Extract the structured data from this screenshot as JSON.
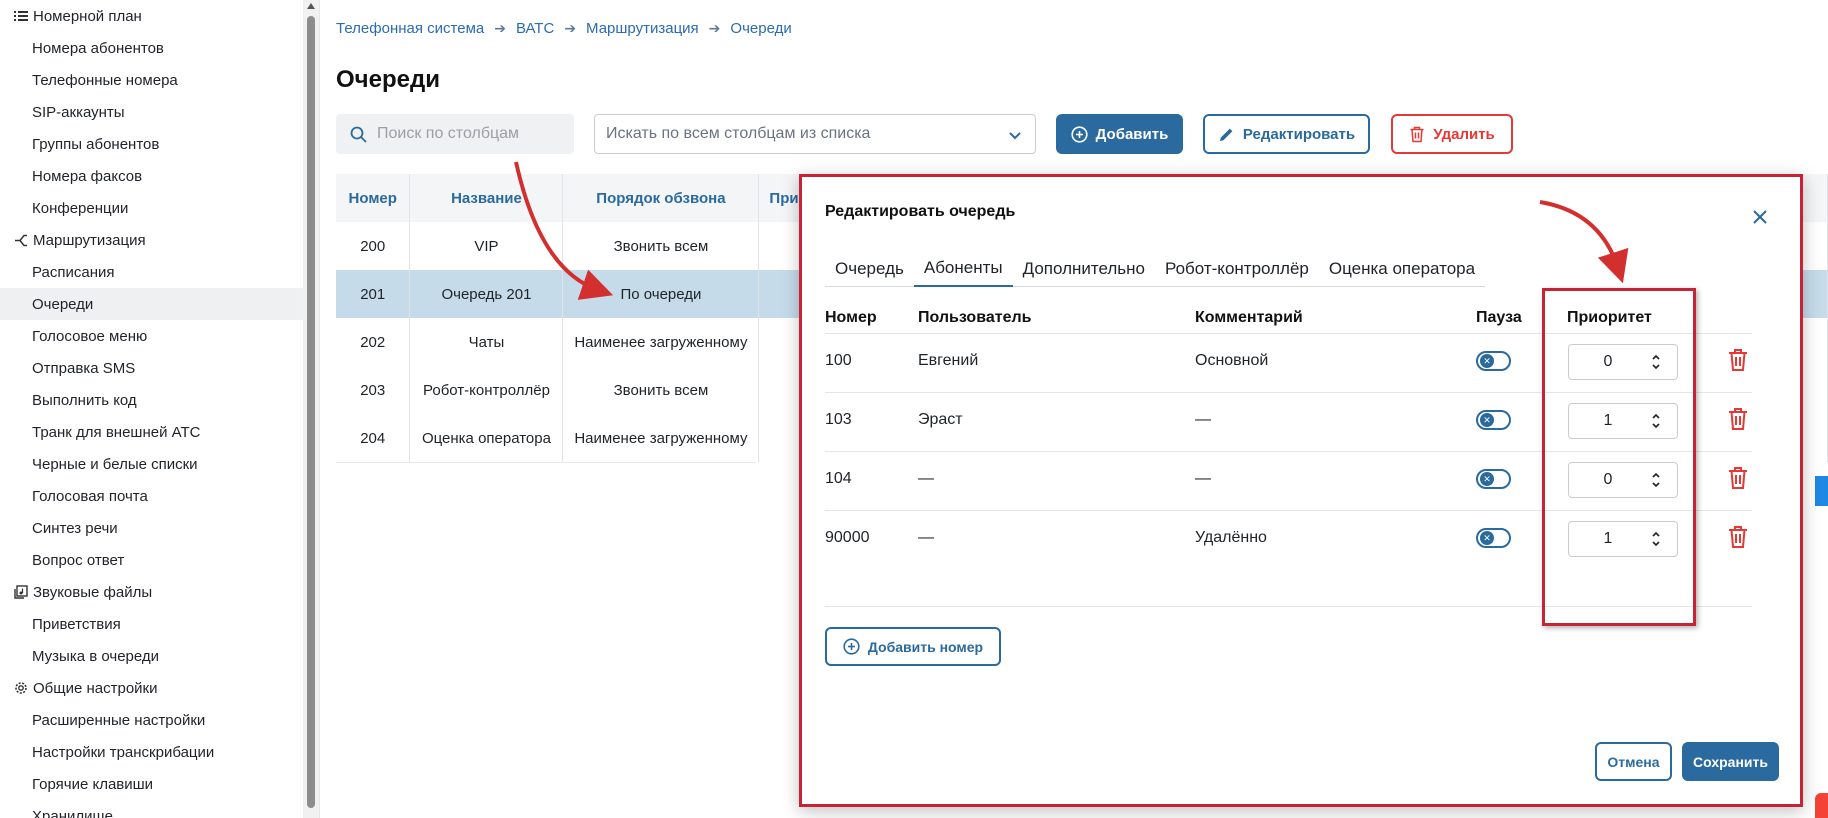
{
  "sidebar": {
    "sections": [
      {
        "title": "Номерной план",
        "icon": "list-icon",
        "items": [
          "Номера абонентов",
          "Телефонные номера",
          "SIP-аккаунты",
          "Группы абонентов",
          "Номера факсов",
          "Конференции"
        ]
      },
      {
        "title": "Маршрутизация",
        "icon": "routing-icon",
        "items": [
          "Расписания",
          "Очереди",
          "Голосовое меню",
          "Отправка SMS",
          "Выполнить код",
          "Транк для внешней АТС",
          "Черные и белые списки",
          "Голосовая почта",
          "Синтез речи",
          "Вопрос ответ"
        ]
      },
      {
        "title": "Звуковые файлы",
        "icon": "audio-files-icon",
        "items": [
          "Приветствия",
          "Музыка в очереди"
        ]
      },
      {
        "title": "Общие настройки",
        "icon": "gear-icon",
        "items": [
          "Расширенные настройки",
          "Настройки транскрибации",
          "Горячие клавиши",
          "Хранилище"
        ]
      }
    ],
    "active_item": "Очереди"
  },
  "breadcrumb": [
    "Телефонная система",
    "ВАТС",
    "Маршрутизация",
    "Очереди"
  ],
  "page_title": "Очереди",
  "toolbar": {
    "search_placeholder": "Поиск по столбцам",
    "column_select_placeholder": "Искать по всем столбцам из списка",
    "add_label": "Добавить",
    "edit_label": "Редактировать",
    "delete_label": "Удалить"
  },
  "queue_table": {
    "headers": [
      "Номер",
      "Название",
      "Порядок обзвона",
      "При"
    ],
    "rows": [
      {
        "number": "200",
        "name": "VIP",
        "order": "Звонить всем"
      },
      {
        "number": "201",
        "name": "Очередь 201",
        "order": "По очереди"
      },
      {
        "number": "202",
        "name": "Чаты",
        "order": "Наименее загруженному"
      },
      {
        "number": "203",
        "name": "Робот-контроллёр",
        "order": "Звонить всем"
      },
      {
        "number": "204",
        "name": "Оценка оператора",
        "order": "Наименее загруженному"
      }
    ],
    "selected_row": 1
  },
  "modal": {
    "title": "Редактировать очередь",
    "tabs": [
      "Очередь",
      "Абоненты",
      "Дополнительно",
      "Робот-контроллёр",
      "Оценка оператора"
    ],
    "active_tab": 1,
    "headers": {
      "number": "Номер",
      "user": "Пользователь",
      "comment": "Комментарий",
      "pause": "Пауза",
      "priority": "Приоритет"
    },
    "rows": [
      {
        "number": "100",
        "user": "Евгений",
        "comment": "Основной",
        "priority": "0"
      },
      {
        "number": "103",
        "user": "Эраст",
        "comment": "—",
        "priority": "1"
      },
      {
        "number": "104",
        "user": "—",
        "comment": "—",
        "priority": "0"
      },
      {
        "number": "90000",
        "user": "—",
        "comment": "Удалённо",
        "priority": "1"
      }
    ],
    "add_number_label": "Добавить номер",
    "cancel_label": "Отмена",
    "save_label": "Сохранить"
  },
  "colors": {
    "accent": "#2a6a9e",
    "danger": "#e53935",
    "annotation": "#c62436",
    "selected_row": "#c6dbe9"
  }
}
